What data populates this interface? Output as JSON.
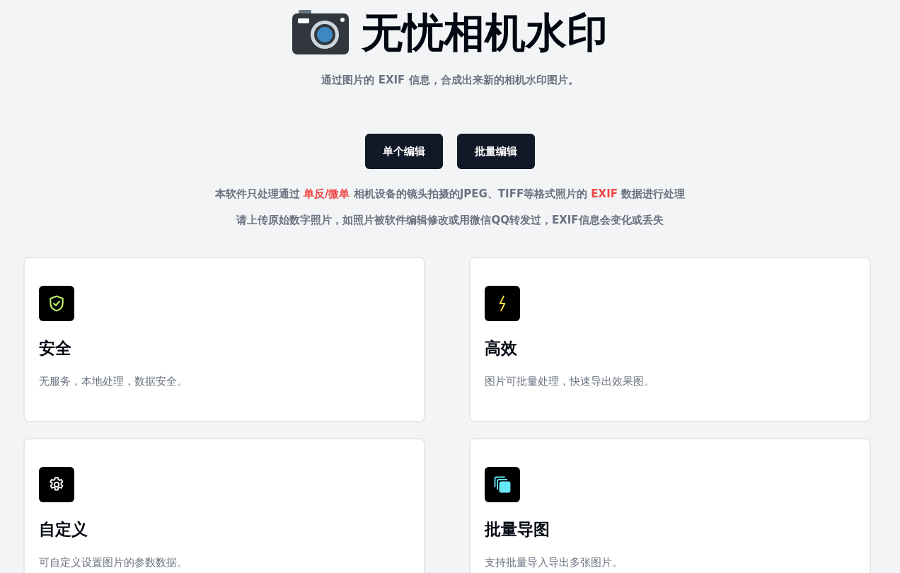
{
  "header": {
    "title": "无忧相机水印",
    "subtitle": "通过图片的 EXIF 信息，合成出来新的相机水印图片。"
  },
  "buttons": [
    "单个编辑",
    "批量编辑"
  ],
  "notice": [
    [
      {
        "text": "本软件只处理通过 ",
        "highlight": false
      },
      {
        "text": "单反/微单",
        "highlight": true
      },
      {
        "text": " 相机设备的镜头拍摄的JPEG、TIFF等格式照片的 ",
        "highlight": false
      },
      {
        "text": "EXIF",
        "highlight": true
      },
      {
        "text": " 数据进行处理",
        "highlight": false
      }
    ],
    [
      {
        "text": "请上传原始数字照片，如照片被软件编辑修改或用微信QQ转发过，EXIF信息会变化或丢失",
        "highlight": false
      }
    ]
  ],
  "features": [
    {
      "title": "安全",
      "description": "无服务，本地处理，数据安全。"
    },
    {
      "title": "高效",
      "description": "图片可批量处理，快速导出效果图。"
    },
    {
      "title": "自定义",
      "description": "可自定义设置图片的参数数据。"
    },
    {
      "title": "批量导图",
      "description": "支持批量导入导出多张图片。"
    }
  ]
}
